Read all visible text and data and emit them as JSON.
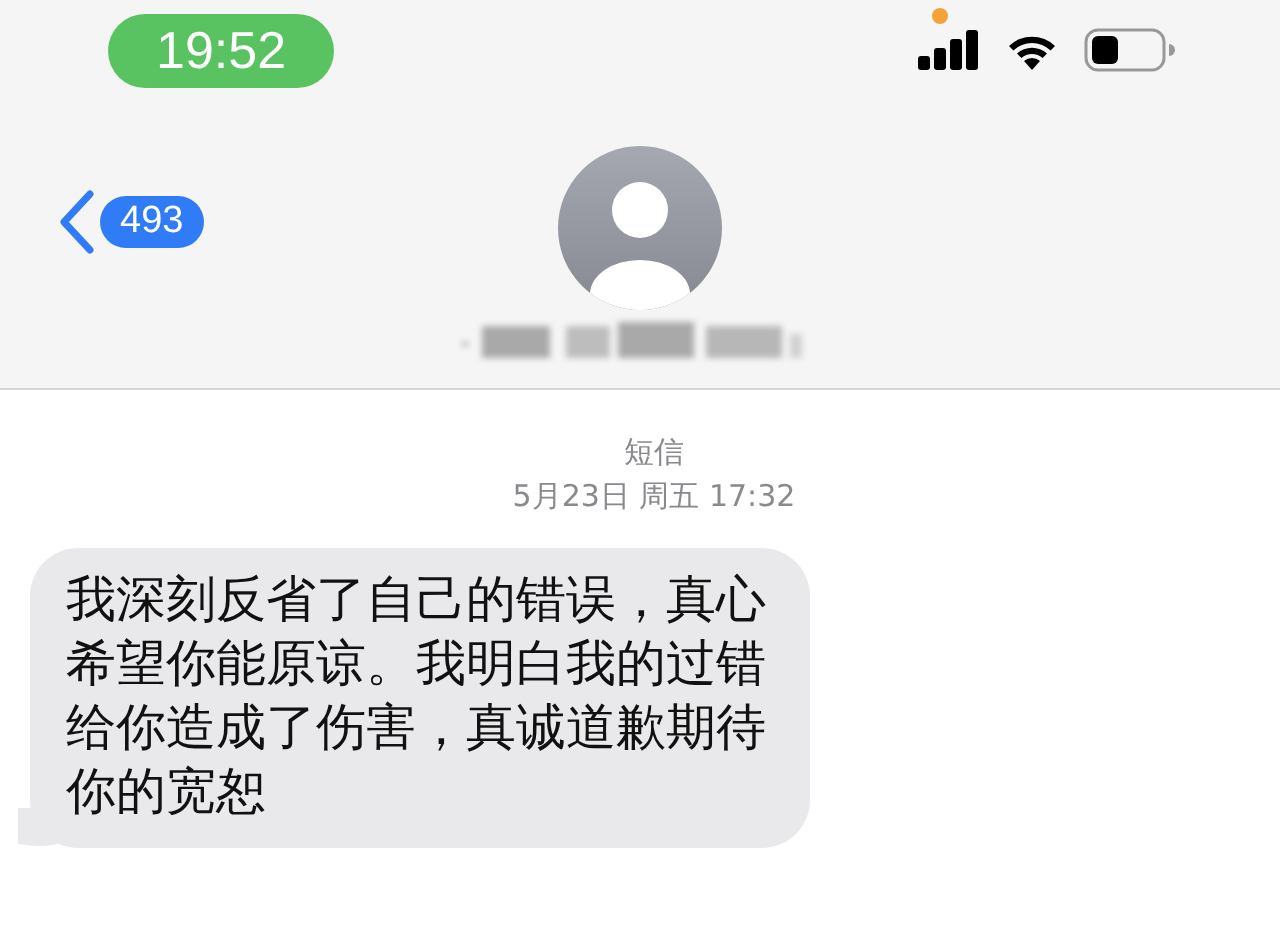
{
  "status_bar": {
    "time": "19:52"
  },
  "nav": {
    "back_count": "493"
  },
  "conversation": {
    "service": "短信",
    "timestamp": "5月23日 周五 17:32",
    "messages": [
      {
        "text": "我深刻反省了自己的错误，真心希望你能原谅。我明白我的过错给你造成了伤害，真诚道歉期待你的宽恕",
        "kind": "incoming"
      }
    ]
  }
}
